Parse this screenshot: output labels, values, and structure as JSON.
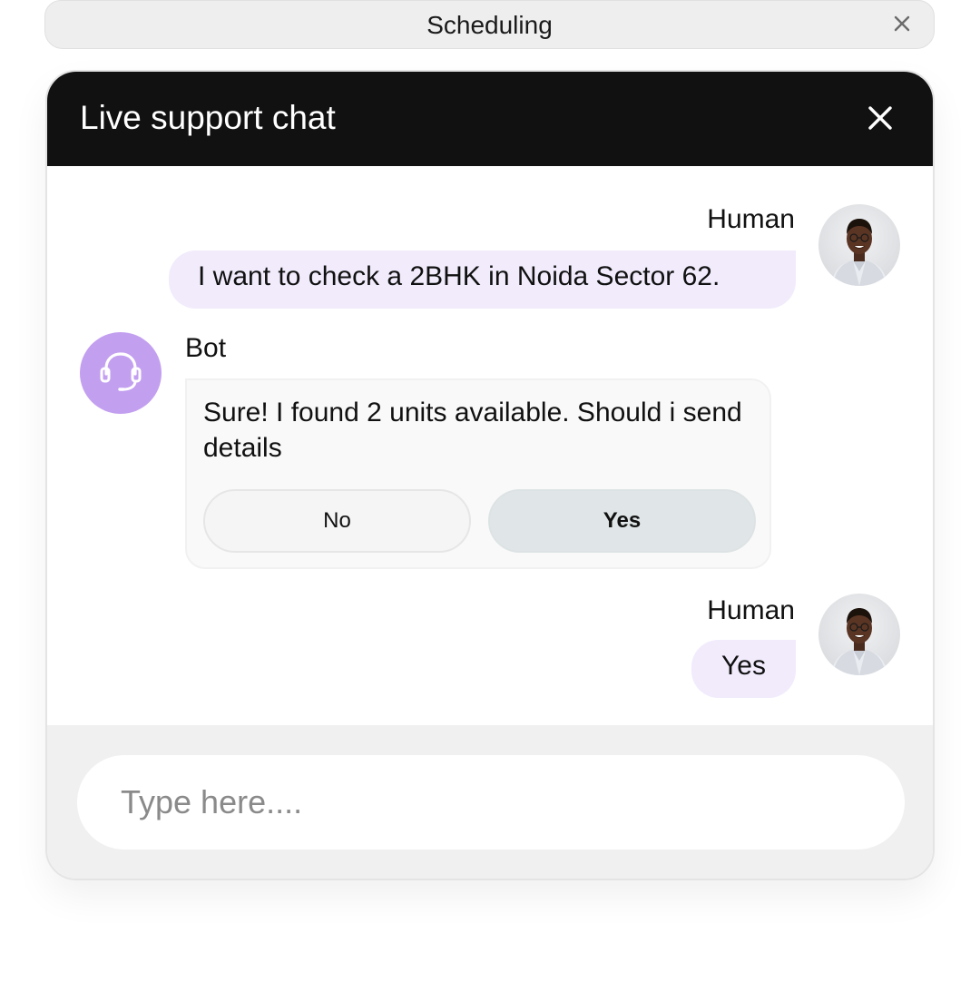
{
  "tab": {
    "title": "Scheduling"
  },
  "chat": {
    "title": "Live support chat",
    "messages": [
      {
        "sender": "Human",
        "text": "I want to check a 2BHK in Noida Sector 62."
      },
      {
        "sender": "Bot",
        "text": "Sure! I found 2 units available. Should i send details",
        "options": [
          {
            "label": "No"
          },
          {
            "label": "Yes"
          }
        ]
      },
      {
        "sender": "Human",
        "text": "Yes"
      }
    ],
    "input": {
      "placeholder": "Type here...."
    }
  },
  "colors": {
    "header_bg": "#111111",
    "human_bubble": "#f1ebfc",
    "bot_avatar": "#c39ff0",
    "selected_option": "#e0e6e7"
  }
}
